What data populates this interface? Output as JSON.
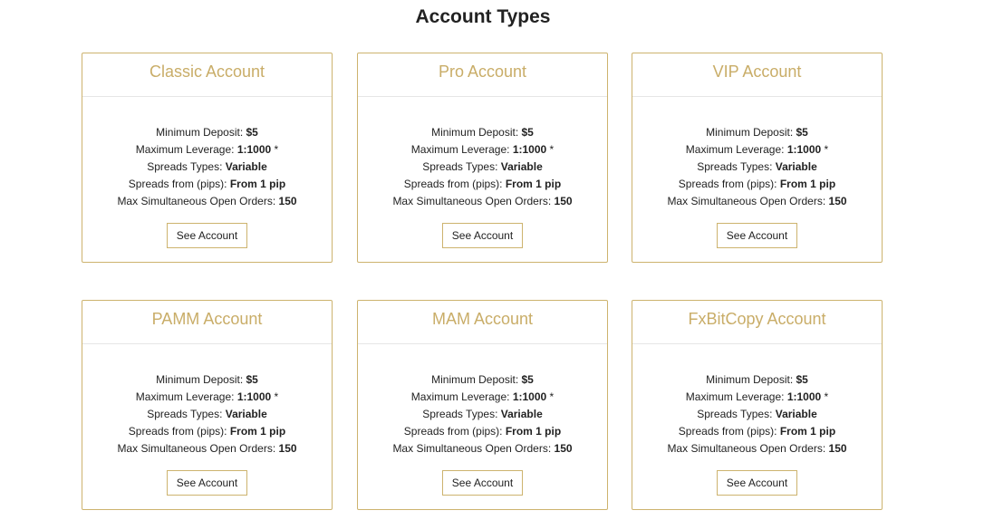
{
  "page": {
    "title": "Account Types"
  },
  "labels": {
    "min_deposit": "Minimum Deposit: ",
    "max_leverage": "Maximum Leverage: ",
    "spreads_types": "Spreads Types: ",
    "spreads_from": "Spreads from (pips): ",
    "max_orders": "Max Simultaneous Open Orders: "
  },
  "accounts": [
    {
      "name": "Classic Account",
      "min_deposit": "$5",
      "max_leverage": "1:1000",
      "leverage_note": " *",
      "spreads_types": "Variable",
      "spreads_from": "From 1 pip",
      "max_orders": "150",
      "button": "See Account"
    },
    {
      "name": "Pro Account",
      "min_deposit": "$5",
      "max_leverage": "1:1000",
      "leverage_note": " *",
      "spreads_types": "Variable",
      "spreads_from": "From 1 pip",
      "max_orders": "150",
      "button": "See Account"
    },
    {
      "name": "VIP Account",
      "min_deposit": "$5",
      "max_leverage": "1:1000",
      "leverage_note": " *",
      "spreads_types": "Variable",
      "spreads_from": "From 1 pip",
      "max_orders": "150",
      "button": "See Account"
    },
    {
      "name": "PAMM Account",
      "min_deposit": "$5",
      "max_leverage": "1:1000",
      "leverage_note": " *",
      "spreads_types": "Variable",
      "spreads_from": "From 1 pip",
      "max_orders": "150",
      "button": "See Account"
    },
    {
      "name": "MAM Account",
      "min_deposit": "$5",
      "max_leverage": "1:1000",
      "leverage_note": " *",
      "spreads_types": "Variable",
      "spreads_from": "From 1 pip",
      "max_orders": "150",
      "button": "See Account"
    },
    {
      "name": "FxBitCopy Account",
      "min_deposit": "$5",
      "max_leverage": "1:1000",
      "leverage_note": " *",
      "spreads_types": "Variable",
      "spreads_from": "From 1 pip",
      "max_orders": "150",
      "button": "See Account"
    }
  ],
  "colors": {
    "accent_gold": "#c9ad68",
    "border_gold": "#cdb36e",
    "text": "#222222"
  }
}
